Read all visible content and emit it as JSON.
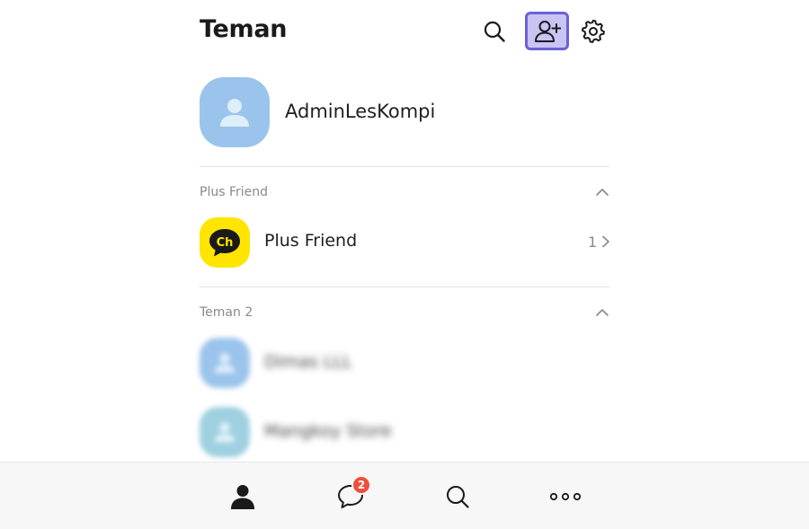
{
  "header": {
    "title": "Teman",
    "icons": {
      "search": "search-icon",
      "add_friend": "add-friend-icon",
      "settings": "gear-icon"
    }
  },
  "profile": {
    "name": "AdminLesKompi"
  },
  "sections": {
    "plus_friend": {
      "label": "Plus Friend",
      "item_name": "Plus Friend",
      "item_icon_text": "Ch",
      "count": "1"
    },
    "friends": {
      "label": "Teman",
      "count": "2",
      "items": [
        {
          "name": "Dimas LLL",
          "avatar_color": "#9bc4ec"
        },
        {
          "name": "Mangkoy Store",
          "avatar_color": "#9fd0e0"
        }
      ]
    }
  },
  "bottom_nav": {
    "items": [
      "friends-icon",
      "chat-icon",
      "search-icon",
      "more-icon"
    ],
    "chat_badge": "2"
  },
  "colors": {
    "accent_highlight": "#c8c4f4",
    "accent_border": "#6b62d6",
    "avatar_blue": "#9bc4ec",
    "plus_friend_yellow": "#ffe500",
    "badge_red": "#ee4f3b"
  }
}
